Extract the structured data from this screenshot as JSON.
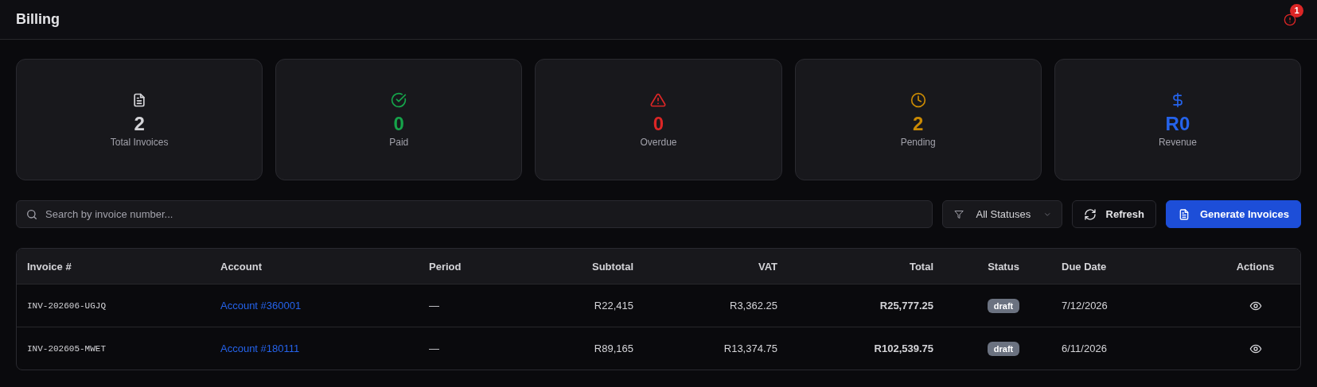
{
  "header": {
    "title": "Billing",
    "alert_count": "1"
  },
  "stats": [
    {
      "kind": "document",
      "value": "2",
      "label": "Total Invoices",
      "color": "#d4d4d8"
    },
    {
      "kind": "check",
      "value": "0",
      "label": "Paid",
      "color": "#16a34a"
    },
    {
      "kind": "alert",
      "value": "0",
      "label": "Overdue",
      "color": "#dc2626"
    },
    {
      "kind": "clock",
      "value": "2",
      "label": "Pending",
      "color": "#ca8a04"
    },
    {
      "kind": "dollar",
      "value": "R0",
      "label": "Revenue",
      "color": "#2563eb"
    }
  ],
  "toolbar": {
    "search": {
      "placeholder": "Search by invoice number..."
    },
    "status_filter": "All Statuses",
    "refresh": "Refresh",
    "generate": "Generate Invoices"
  },
  "table": {
    "columns": [
      "Invoice #",
      "Account",
      "Period",
      "Subtotal",
      "VAT",
      "Total",
      "Status",
      "Due Date",
      "Actions"
    ],
    "rows": [
      {
        "invoice": "INV-202606-UGJQ",
        "account": "Account #360001",
        "period": "—",
        "subtotal": "R22,415",
        "vat": "R3,362.25",
        "total": "R25,777.25",
        "status": "draft",
        "due_date": "7/12/2026"
      },
      {
        "invoice": "INV-202605-MWET",
        "account": "Account #180111",
        "period": "—",
        "subtotal": "R89,165",
        "vat": "R13,374.75",
        "total": "R102,539.75",
        "status": "draft",
        "due_date": "6/11/2026"
      }
    ]
  }
}
